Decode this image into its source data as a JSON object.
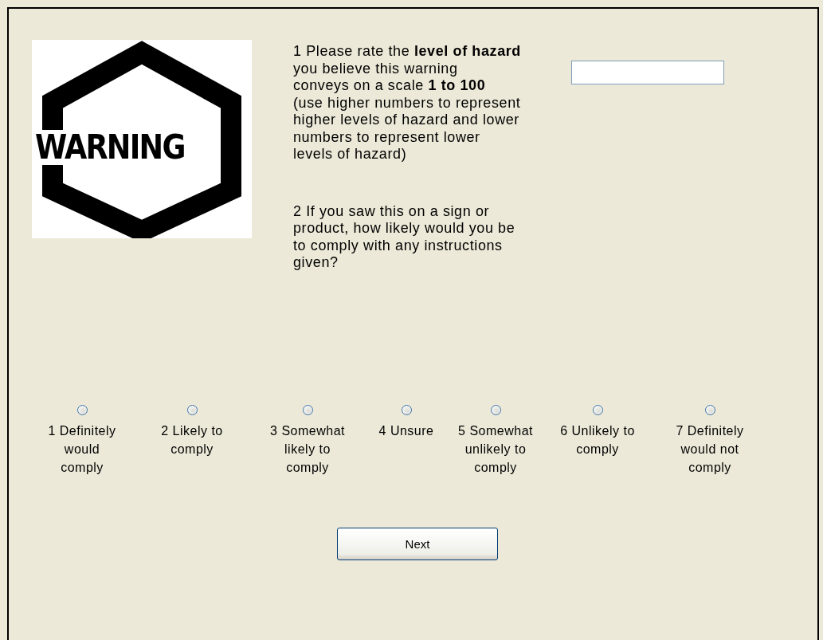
{
  "warning_sign": {
    "label": "WARNING"
  },
  "question_1": {
    "text": "1 Please rate the **level of hazard**\nyou believe this warning\nconveys on a scale **1 to 100**\n(use higher numbers to represent\nhigher levels of hazard and lower\nnumbers to represent lower\nlevels of hazard)"
  },
  "question_2": {
    "text": "2 If you saw this on a sign or\nproduct, how likely would you be\nto comply with any instructions\ngiven?"
  },
  "options": [
    {
      "label": "1 Definitely\nwould\ncomply",
      "selected": false
    },
    {
      "label": "2 Likely to\ncomply",
      "selected": false
    },
    {
      "label": "3 Somewhat\nlikely to\ncomply",
      "selected": false
    },
    {
      "label": "4 Unsure",
      "selected": false
    },
    {
      "label": "5 Somewhat\nunlikely to\ncomply",
      "selected": false
    },
    {
      "label": "6 Unlikely to\ncomply",
      "selected": false
    },
    {
      "label": "7 Definitely\nwould not\ncomply",
      "selected": false
    }
  ],
  "next_button": {
    "label": "Next"
  }
}
